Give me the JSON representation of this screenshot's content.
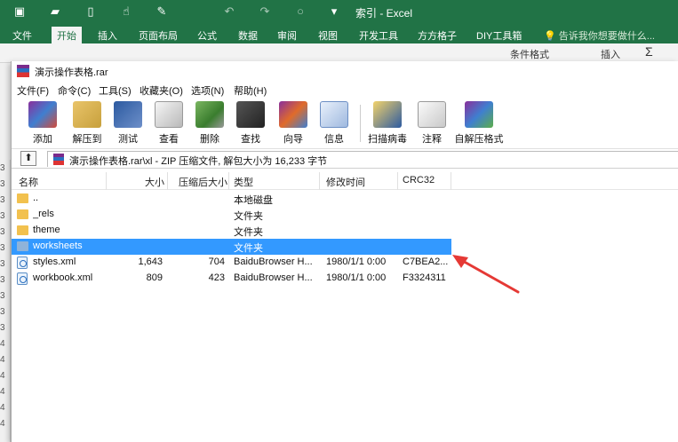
{
  "excel": {
    "title": "索引 - Excel",
    "tabs": [
      "文件",
      "开始",
      "插入",
      "页面布局",
      "公式",
      "数据",
      "审阅",
      "视图",
      "开发工具",
      "方方格子",
      "DIY工具箱"
    ],
    "active_tab": "开始",
    "tell_me": "告诉我你想要做什么...",
    "ribbon_right": [
      "条件格式",
      "插入",
      "Σ"
    ],
    "row_numbers": [
      "3",
      "3",
      "3",
      "3",
      "3",
      "3",
      "3",
      "3",
      "3",
      "3",
      "3",
      "4",
      "4",
      "4",
      "4",
      "4",
      "4"
    ]
  },
  "rar": {
    "title": "演示操作表格.rar",
    "menu": [
      "文件(F)",
      "命令(C)",
      "工具(S)",
      "收藏夹(O)",
      "选项(N)",
      "帮助(H)"
    ],
    "tools": [
      "添加",
      "解压到",
      "测试",
      "查看",
      "删除",
      "查找",
      "向导",
      "信息",
      "扫描病毒",
      "注释",
      "自解压格式"
    ],
    "address": "演示操作表格.rar\\xl - ZIP 压缩文件, 解包大小为 16,233 字节",
    "columns": [
      "名称",
      "大小",
      "压缩后大小",
      "类型",
      "修改时间",
      "CRC32"
    ],
    "files": [
      {
        "name": "..",
        "size": "",
        "packed": "",
        "type": "本地磁盘",
        "modified": "",
        "crc": "",
        "kind": "folder"
      },
      {
        "name": "_rels",
        "size": "",
        "packed": "",
        "type": "文件夹",
        "modified": "",
        "crc": "",
        "kind": "folder"
      },
      {
        "name": "theme",
        "size": "",
        "packed": "",
        "type": "文件夹",
        "modified": "",
        "crc": "",
        "kind": "folder"
      },
      {
        "name": "worksheets",
        "size": "",
        "packed": "",
        "type": "文件夹",
        "modified": "",
        "crc": "",
        "kind": "folder",
        "selected": true
      },
      {
        "name": "styles.xml",
        "size": "1,643",
        "packed": "704",
        "type": "BaiduBrowser H...",
        "modified": "1980/1/1 0:00",
        "crc": "C7BEA2...",
        "kind": "xml"
      },
      {
        "name": "workbook.xml",
        "size": "809",
        "packed": "423",
        "type": "BaiduBrowser H...",
        "modified": "1980/1/1 0:00",
        "crc": "F3324311",
        "kind": "xml"
      }
    ]
  },
  "colors": {
    "excel_green": "#217346",
    "selection": "#3399ff",
    "arrow": "#e53935"
  }
}
